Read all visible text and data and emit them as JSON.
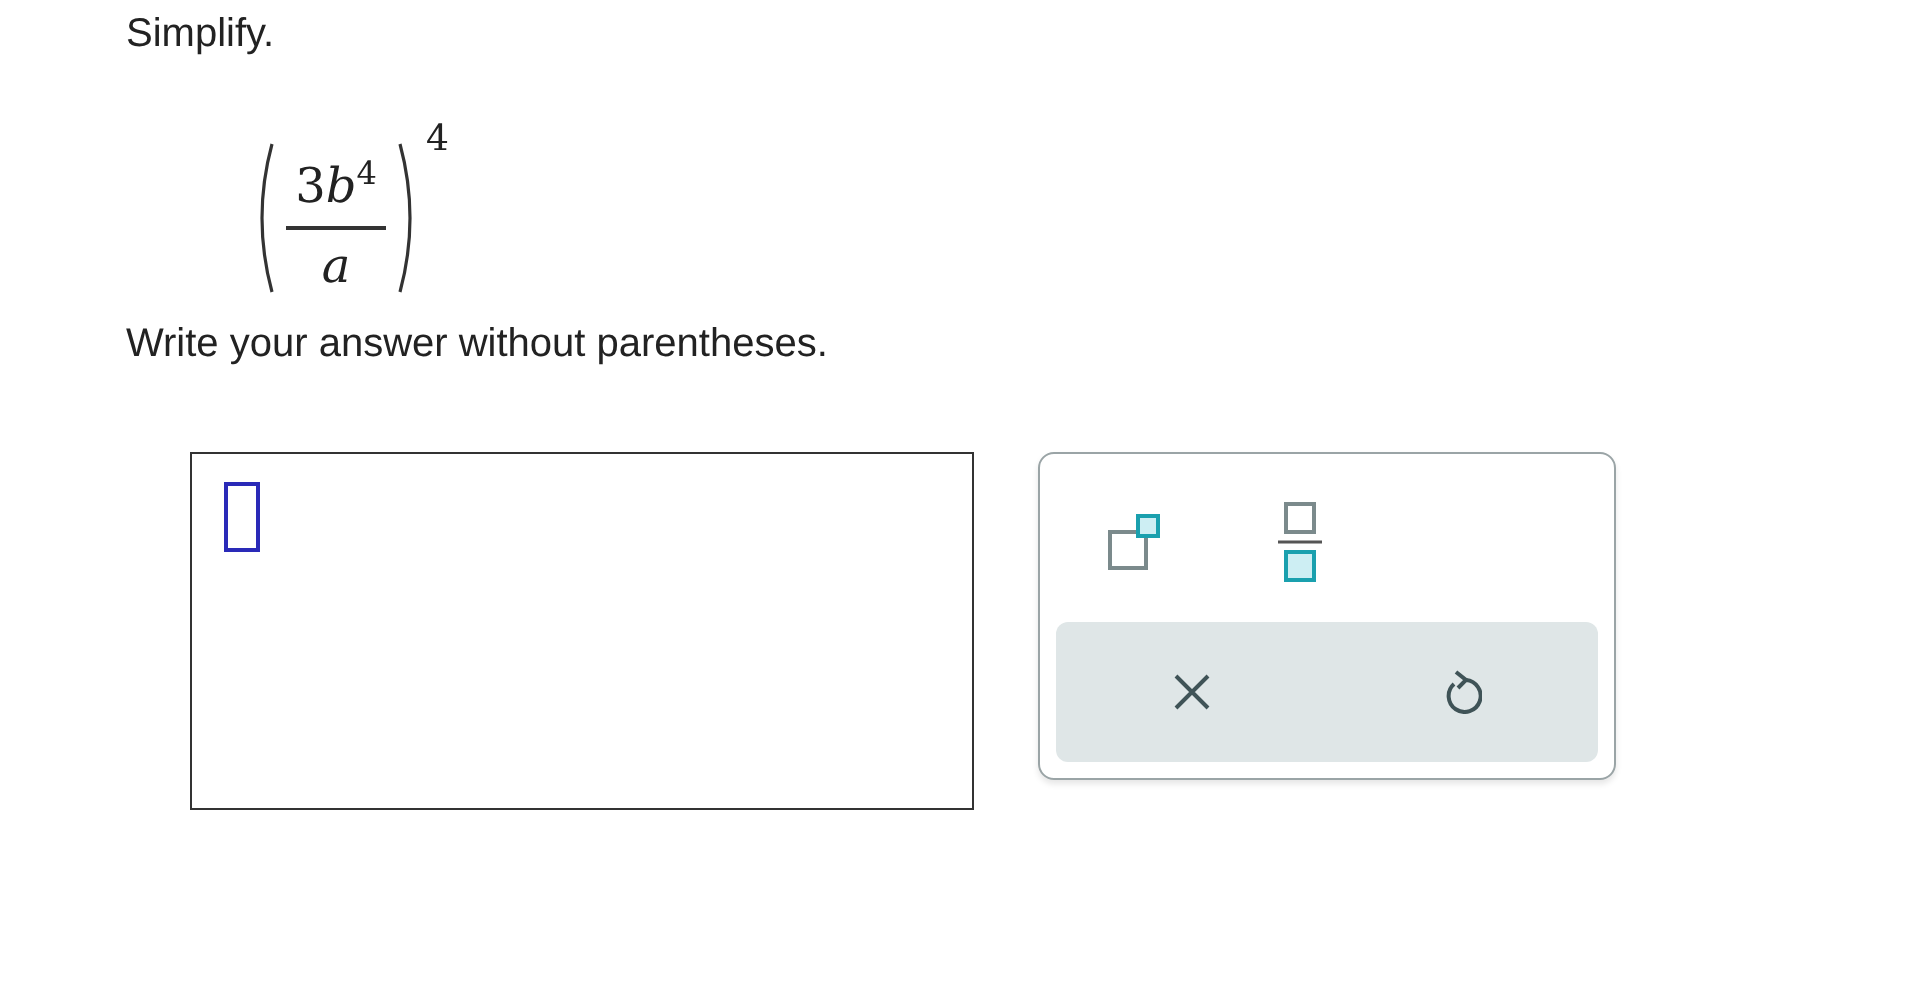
{
  "instruction": "Simplify.",
  "expression": {
    "coefficient": "3",
    "variable": "b",
    "power": "4",
    "denominator": "a",
    "exponent": "4"
  },
  "note": "Write your answer without parentheses.",
  "answer": {
    "cursor": true
  },
  "palette": {
    "templates": [
      {
        "kind": "superscript"
      },
      {
        "kind": "fraction"
      }
    ],
    "actions": [
      {
        "kind": "clear"
      },
      {
        "kind": "undo"
      }
    ]
  }
}
